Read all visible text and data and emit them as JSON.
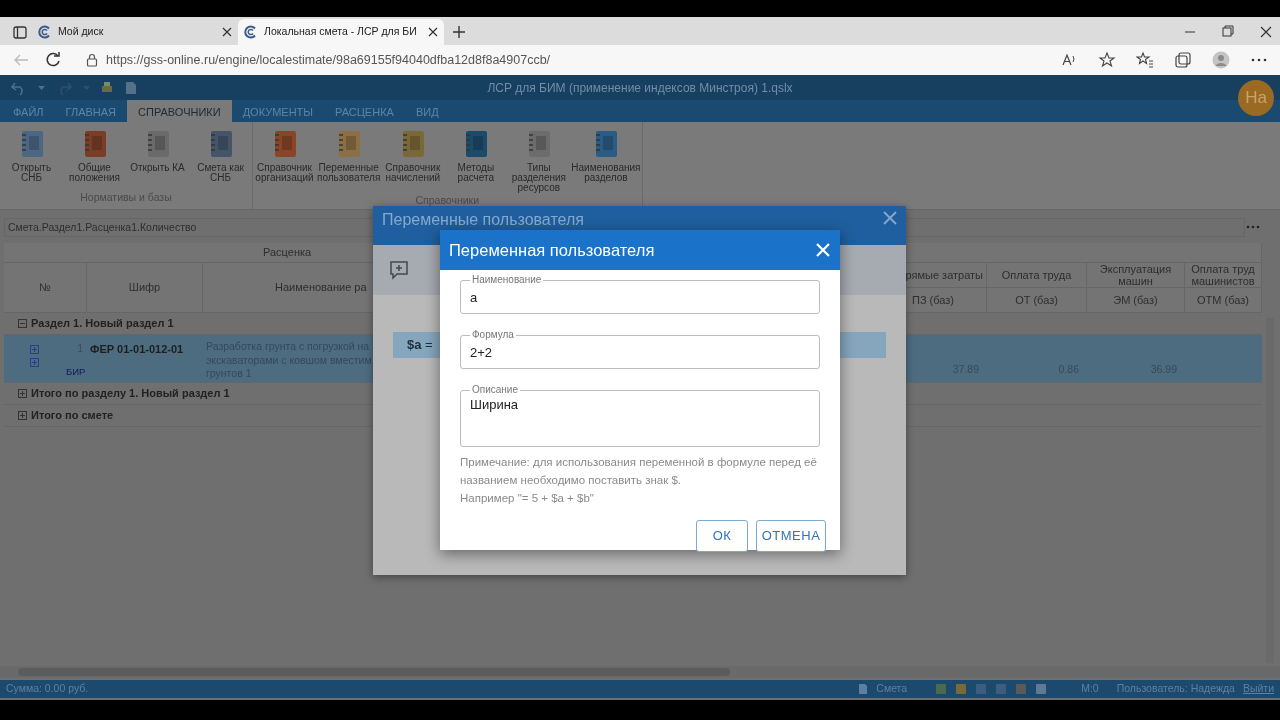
{
  "browser": {
    "tabs": [
      {
        "title": "Мой диск",
        "selected": false
      },
      {
        "title": "Локальная смета - ЛСР для БИ",
        "selected": true
      }
    ],
    "url": "https://gss-online.ru/engine/localestimate/98a69155f94040dfba12d8f8a4907ccb/"
  },
  "app": {
    "title": "ЛСР для БИМ (применение индексов Минстроя) 1.qslx",
    "avatar": "На",
    "ribbon_tabs": [
      {
        "label": "ФАЙЛ",
        "selected": false
      },
      {
        "label": "ГЛАВНАЯ",
        "selected": false
      },
      {
        "label": "СПРАВОЧНИКИ",
        "selected": true
      },
      {
        "label": "ДОКУМЕНТЫ",
        "selected": false
      },
      {
        "label": "РАСЦЕНКА",
        "selected": false
      },
      {
        "label": "ВИД",
        "selected": false
      }
    ],
    "ribbon_groups": [
      {
        "label": "Нормативы и базы",
        "buttons": [
          "Открыть СНБ",
          "Общие положения",
          "Открыть КА",
          "Смета как СНБ"
        ]
      },
      {
        "label": "Справочники",
        "buttons": [
          "Справочник организаций",
          "Переменные пользователя",
          "Справочник начислений",
          "Методы расчета",
          "Типы разделения ресурсов",
          "Наименования разделов"
        ]
      }
    ],
    "formula_bar": "Смета.Раздел1.Расценка1.Количество",
    "table": {
      "group_header": "Расценка",
      "left_columns": [
        "№",
        "Шифр",
        "Наименование ра"
      ],
      "right_columns": [
        {
          "title": "рямые затраты",
          "code": "ПЗ (баз)"
        },
        {
          "title": "Оплата труда",
          "code": "ОТ (баз)"
        },
        {
          "title": "Эксплуатация машин",
          "code": "ЭМ (баз)"
        },
        {
          "title": "Оплата труд машинистов",
          "code": "ОТМ (баз)"
        }
      ],
      "rows": [
        {
          "kind": "section",
          "label": "Раздел 1. Новый раздел 1",
          "expanded": true
        },
        {
          "kind": "item",
          "number": "1",
          "code": "ФЕР 01-01-012-01",
          "link": "БИР",
          "name": "Разработка грунта с погрузкой на экскаваторами с ковшом вместим грунтов 1",
          "values": [
            "37.89",
            "0.86",
            "36.99"
          ],
          "selected": true
        },
        {
          "kind": "section",
          "label": "Итого по разделу 1. Новый раздел 1",
          "expanded": false
        },
        {
          "kind": "section",
          "label": "Итого по смете",
          "expanded": false
        }
      ]
    },
    "status_bar": {
      "sum": "Сумма: 0.00 руб.",
      "mode": "Смета",
      "memory": "М:0",
      "user": "Пользователь: Надежда",
      "logout": "Выйти"
    }
  },
  "variables_dialog": {
    "title": "Переменные пользователя",
    "items": [
      "**$a** ="
    ]
  },
  "variable_dialog": {
    "title": "Переменная пользователя",
    "fields": [
      {
        "label": "Наименование",
        "value": "а",
        "kind": "input"
      },
      {
        "label": "Формула",
        "value": "2+2",
        "kind": "input"
      },
      {
        "label": "Описание",
        "value": "Ширина",
        "kind": "textarea"
      }
    ],
    "note": [
      "Примечание: для использования переменной в формуле перед её названием необходимо поставить знак $.",
      "Например \"= 5 + $a + $b\""
    ],
    "buttons": [
      "ОК",
      "ОТМЕНА"
    ]
  }
}
